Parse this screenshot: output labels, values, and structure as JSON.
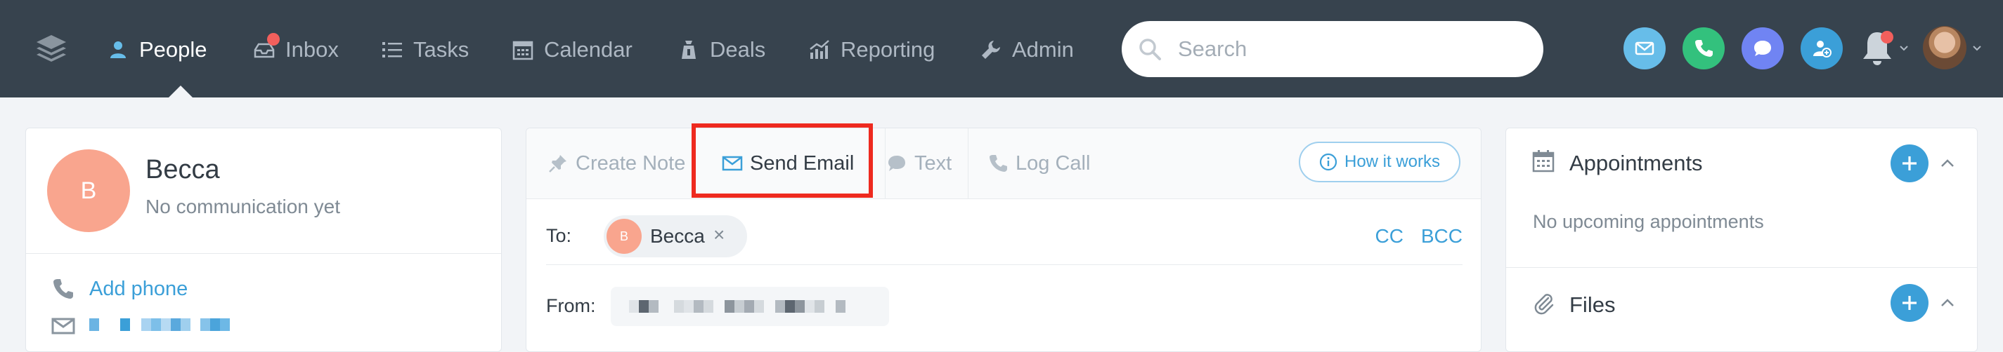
{
  "nav": {
    "items": [
      {
        "label": "People",
        "icon": "person-icon"
      },
      {
        "label": "Inbox",
        "icon": "inbox-icon"
      },
      {
        "label": "Tasks",
        "icon": "list-icon"
      },
      {
        "label": "Calendar",
        "icon": "calendar-icon"
      },
      {
        "label": "Deals",
        "icon": "deals-icon"
      },
      {
        "label": "Reporting",
        "icon": "chart-icon"
      },
      {
        "label": "Admin",
        "icon": "wrench-icon"
      }
    ],
    "active": "People",
    "search_placeholder": "Search"
  },
  "colors": {
    "nav_bg": "#37434e",
    "accent": "#3b9fd8",
    "avatar": "#f9a58e",
    "highlight": "#ee2a1f",
    "email_circle": "#67bde9",
    "call_circle": "#33c17d",
    "chat_circle": "#7084f3",
    "addcontact_circle": "#3b9fd8"
  },
  "contact": {
    "initial": "B",
    "name": "Becca",
    "status": "No communication yet",
    "add_phone": "Add phone"
  },
  "composer": {
    "tabs": [
      "Create Note",
      "Send Email",
      "Text",
      "Log Call"
    ],
    "active_tab": "Send Email",
    "how_it_works": "How it works",
    "to_label": "To:",
    "recipient_initial": "B",
    "recipient": "Becca",
    "remove": "×",
    "cc": "CC",
    "bcc": "BCC",
    "from_label": "From:"
  },
  "sidebar": {
    "appointments_title": "Appointments",
    "appointments_empty": "No upcoming appointments",
    "files_title": "Files"
  }
}
